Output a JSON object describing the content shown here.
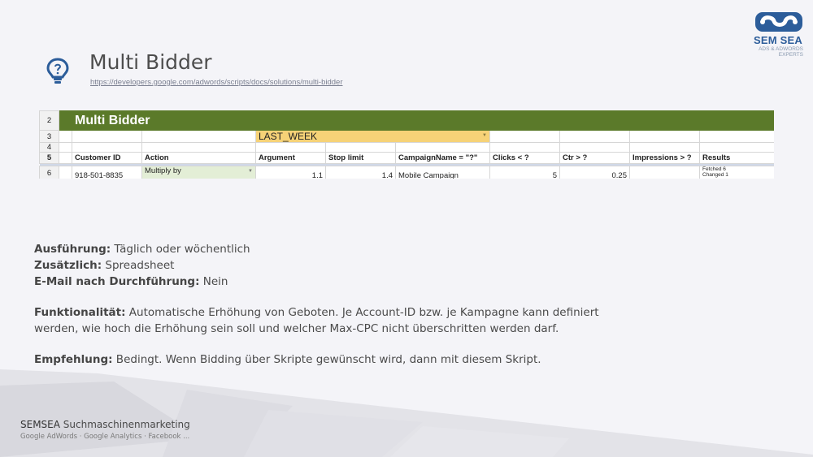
{
  "brand": {
    "logo_title": "SEM SEA",
    "logo_sub1": "ADS & ADWORDS",
    "logo_sub2": "EXPERTS",
    "accent": "#2c5d9a"
  },
  "header": {
    "title": "Multi Bidder",
    "link": "https://developers.google.com/adwords/scripts/docs/solutions/multi-bidder",
    "icon": "lightbulb-icon"
  },
  "sheet": {
    "band_color": "#5b7a2a",
    "row_numbers": [
      "2",
      "3",
      "4",
      "5",
      "6"
    ],
    "banner": "Multi Bidder",
    "date_range": "LAST_WEEK",
    "headers": [
      "Customer ID",
      "Action",
      "Argument",
      "Stop limit",
      "CampaignName = \"?\"",
      "Clicks < ?",
      "Ctr > ?",
      "Impressions > ?",
      "Results"
    ],
    "row": {
      "customer_id": "918-501-8835",
      "action": "Multiply by",
      "argument": "1.1",
      "stop_limit": "1.4",
      "campaign_name": "Mobile Campaign",
      "clicks": "5",
      "ctr": "0.25",
      "impressions": "",
      "results_1": "Fetched 6",
      "results_2": "Changed 1"
    }
  },
  "content": {
    "l1_label": "Ausführung:",
    "l1_value": " Täglich oder wöchentlich",
    "l2_label": "Zusätzlich:",
    "l2_value": " Spreadsheet",
    "l3_label": "E-Mail nach Durchführung:",
    "l3_value": " Nein",
    "l4_label": "Funktionalität:",
    "l4_value": " Automatische Erhöhung von Geboten. Je Account-ID bzw. je Kampagne kann definiert werden, wie hoch die Erhöhung sein soll und welcher Max-CPC nicht überschritten werden darf.",
    "l5_label": "Empfehlung:",
    "l5_value": " Bedingt. Wenn Bidding über Skripte gewünscht wird, dann mit diesem Skript."
  },
  "footer": {
    "company": "SEMSEA",
    "company_suffix": " Suchmaschinenmarketing",
    "services": "Google AdWords · Google Analytics · Facebook ..."
  }
}
